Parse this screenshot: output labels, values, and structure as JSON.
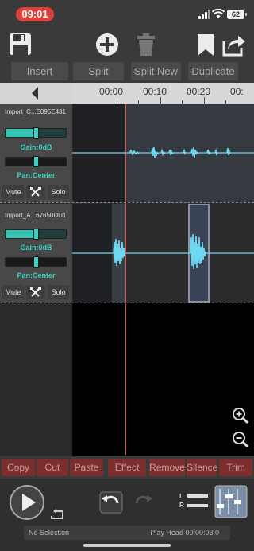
{
  "status_bar": {
    "time": "09:01",
    "battery": "62"
  },
  "toolbar": {
    "save_icon": "floppy-disk-icon",
    "add_icon": "plus-circle-icon",
    "delete_icon": "trash-icon",
    "bookmark_icon": "bookmark-icon",
    "share_icon": "share-icon"
  },
  "edit_buttons": {
    "insert": "Insert",
    "split": "Split",
    "split_new": "Split New",
    "duplicate": "Duplicate"
  },
  "timeline": {
    "labels": [
      "00:00",
      "00:10",
      "00:20",
      "00:"
    ]
  },
  "tracks": [
    {
      "name": "Import_C...E096E431",
      "gain_label": "Gain:0dB",
      "pan_label": "Pan:Center",
      "mute": "Mute",
      "solo": "Solo",
      "gain_fraction": 0.5,
      "pan_fraction": 0.5
    },
    {
      "name": "Import_A...67650DD1",
      "gain_label": "Gain:0dB",
      "pan_label": "Pan:Center",
      "mute": "Mute",
      "solo": "Solo",
      "gain_fraction": 0.5,
      "pan_fraction": 0.5
    }
  ],
  "zoom": {
    "in_icon": "zoom-in-icon",
    "out_icon": "zoom-out-icon"
  },
  "bottom_buttons": {
    "copy": "Copy",
    "cut": "Cut",
    "paste": "Paste",
    "effect": "Effect",
    "remove": "Remove",
    "silence": "Silence",
    "trim": "Trim"
  },
  "transport": {
    "play_icon": "play-icon",
    "loop_icon": "loop-icon",
    "undo_icon": "undo-icon",
    "redo_icon": "redo-icon",
    "level_left": "L",
    "level_right": "R",
    "mixer_icon": "mixer-icon"
  },
  "status": {
    "selection": "No Selection",
    "play_head": "Play Head 00:00:03.0"
  },
  "colors": {
    "accent": "#36c4b4",
    "waveform": "#6fd8f0",
    "playhead": "#d9534f",
    "edit_button": "#7a2f2e",
    "status_time": "#e0403a"
  }
}
